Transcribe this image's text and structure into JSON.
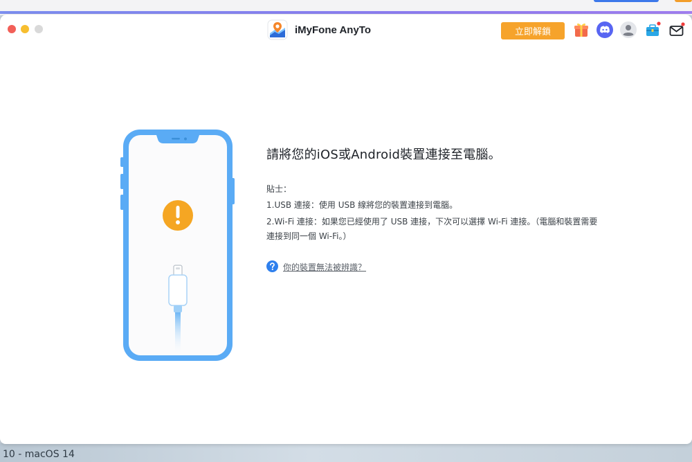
{
  "app": {
    "title": "iMyFone AnyTo"
  },
  "toolbar": {
    "unlock_label": "立即解鎖",
    "icons": [
      "gift-icon",
      "discord-icon",
      "user-icon",
      "toolbox-icon",
      "mail-icon"
    ]
  },
  "main": {
    "heading": "請將您的iOS或Android裝置連接至電腦。",
    "tips_label": "貼士：",
    "tip_usb": "1.USB 連接：使用 USB 線將您的裝置連接到電腦。",
    "tip_wifi": "2.Wi-Fi 連接：如果您已經使用了 USB 連接，下次可以選擇 Wi-Fi 連接。（電腦和裝置需要連接到同一個 Wi-Fi。）",
    "help_link": "你的裝置無法被辨識？"
  },
  "footer": {
    "caption": "10 - macOS 14"
  },
  "colors": {
    "accent_orange": "#f6a32b",
    "phone_blue": "#5aabf5",
    "help_blue": "#2f80ed",
    "warning_orange": "#f5a623"
  }
}
